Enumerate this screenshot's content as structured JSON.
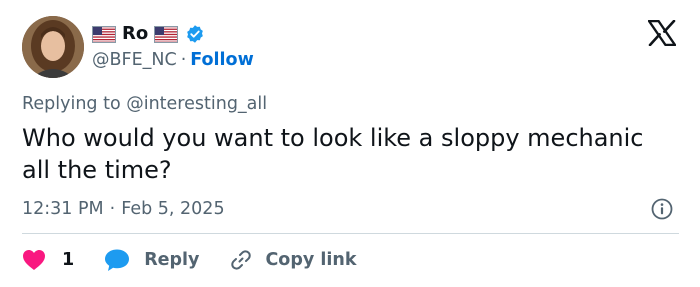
{
  "author": {
    "display_name": "Ro",
    "handle": "@BFE_NC",
    "separator": "·",
    "follow_label": "Follow",
    "flag_icon": "us-flag-icon",
    "verified_icon": "verified-badge-icon"
  },
  "brand": {
    "logo_icon": "x-logo-icon"
  },
  "tweet": {
    "replying_to": "Replying to @interesting_all",
    "text": "Who would you want to look like a sloppy mechanic all the time?",
    "time": "12:31 PM",
    "date_separator": "·",
    "date": "Feb 5, 2025",
    "info_icon": "info-icon"
  },
  "actions": {
    "like_count": "1",
    "like_icon": "heart-icon",
    "reply_label": "Reply",
    "reply_icon": "speech-bubble-icon",
    "copy_label": "Copy link",
    "copy_icon": "link-icon"
  },
  "colors": {
    "text": "#0f1419",
    "secondary_text": "#536471",
    "follow": "#006fd6",
    "verified": "#1d9bf0",
    "heart": "#f91880",
    "reply_bubble": "#1d9bf0",
    "divider": "#cfd9de"
  }
}
